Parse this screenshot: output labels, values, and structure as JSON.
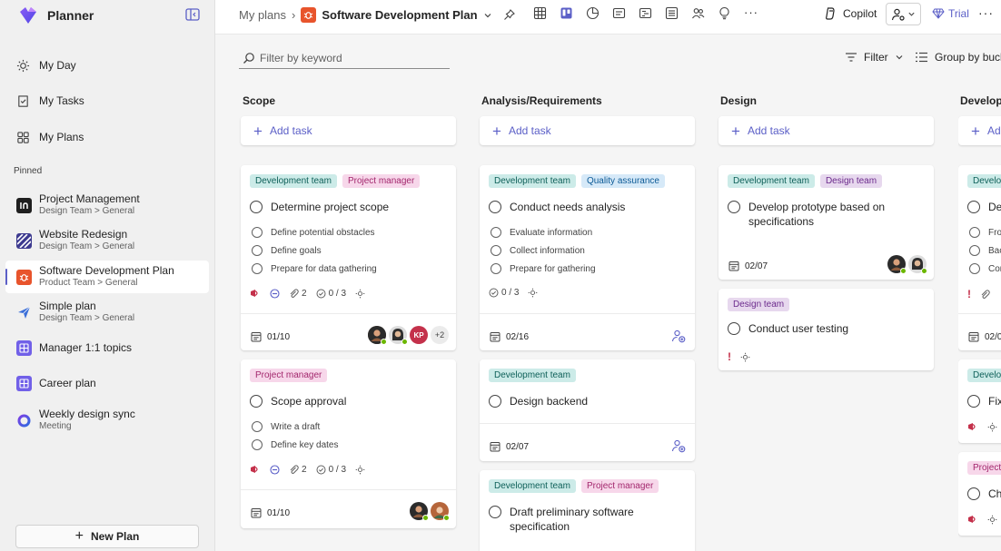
{
  "app": {
    "name": "Planner",
    "accent": "#5b5fc7"
  },
  "nav": [
    {
      "label": "My Day",
      "icon": "sun-icon"
    },
    {
      "label": "My Tasks",
      "icon": "tasks-icon"
    },
    {
      "label": "My Plans",
      "icon": "grid-icon"
    }
  ],
  "pinned": {
    "label": "Pinned",
    "items": [
      {
        "title": "Project Management",
        "sub": "Design Team > General"
      },
      {
        "title": "Website Redesign",
        "sub": "Design Team > General"
      },
      {
        "title": "Software Development Plan",
        "sub": "Product Team > General",
        "active": true
      },
      {
        "title": "Simple plan",
        "sub": "Design Team > General"
      },
      {
        "title": "Manager 1:1 topics",
        "sub": ""
      },
      {
        "title": "Career plan",
        "sub": ""
      },
      {
        "title": "Weekly design sync",
        "sub": "Meeting"
      }
    ]
  },
  "new_plan": "New Plan",
  "header": {
    "breadcrumb_root": "My plans",
    "plan_title": "Software Development Plan",
    "copilot": "Copilot",
    "trial": "Trial"
  },
  "toolbar": {
    "filter_placeholder": "Filter by keyword",
    "filter": "Filter",
    "group_by": "Group by buck"
  },
  "buckets": [
    {
      "title": "Scope",
      "add_task": "Add task",
      "cards": [
        {
          "labels": [
            "Development team",
            "Project manager"
          ],
          "title": "Determine project scope",
          "checklist": [
            "Define potential obstacles",
            "Define goals",
            "Prepare for data gathering"
          ],
          "attachments": "2",
          "progress": "0 / 3",
          "due": "01/10",
          "avatar_initials": "KP",
          "more": "+2"
        },
        {
          "labels": [
            "Project manager"
          ],
          "title": "Scope approval",
          "checklist": [
            "Write a draft",
            "Define key dates"
          ],
          "attachments": "2",
          "progress": "0 / 3",
          "due": "01/10"
        }
      ]
    },
    {
      "title": "Analysis/Requirements",
      "add_task": "Add task",
      "cards": [
        {
          "labels": [
            "Development team",
            "Quality assurance"
          ],
          "title": "Conduct needs analysis",
          "checklist": [
            "Evaluate information",
            "Collect information",
            "Prepare for gathering"
          ],
          "progress": "0 / 3",
          "due": "02/16"
        },
        {
          "labels": [
            "Development team"
          ],
          "title": "Design backend",
          "due": "02/07"
        },
        {
          "labels": [
            "Development team",
            "Project manager"
          ],
          "title": "Draft preliminary software specification"
        }
      ]
    },
    {
      "title": "Design",
      "add_task": "Add task",
      "cards": [
        {
          "labels": [
            "Development team",
            "Design team"
          ],
          "title": "Develop prototype based on specifications",
          "due": "02/07"
        },
        {
          "labels": [
            "Design team"
          ],
          "title": "Conduct user testing"
        }
      ]
    },
    {
      "title": "Develop",
      "add_task": "Ad",
      "partial": {
        "label1": "Develo",
        "title1": "De",
        "checks": [
          "Fro",
          "Bac",
          "Cor"
        ],
        "due": "02/0",
        "label2": "Develo",
        "title2": "Fix",
        "label3": "Project",
        "title3": "Ch"
      }
    }
  ]
}
